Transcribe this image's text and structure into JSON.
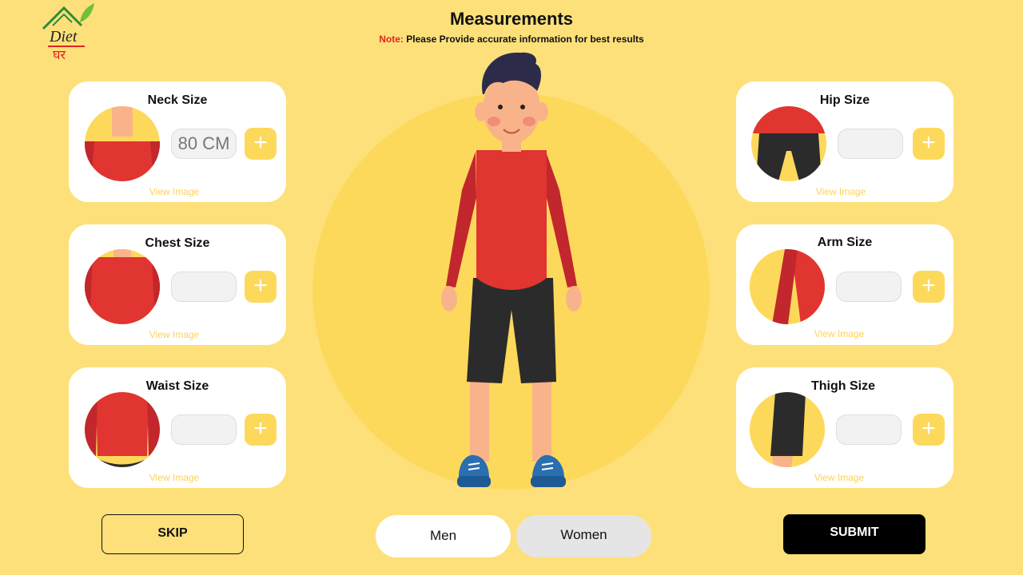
{
  "brand": {
    "logo_line1": "Diet",
    "logo_line2": "घर"
  },
  "header": {
    "title": "Measurements",
    "note_label": "Note:",
    "note_text": "Please Provide accurate information for best results"
  },
  "measurements": {
    "neck": {
      "title": "Neck Size",
      "value": "80 CM",
      "view_label": "View Image",
      "add_label": "+",
      "icon": "neck-icon"
    },
    "chest": {
      "title": "Chest Size",
      "value": "",
      "view_label": "View Image",
      "add_label": "+",
      "icon": "chest-icon"
    },
    "waist": {
      "title": "Waist Size",
      "value": "",
      "view_label": "View Image",
      "add_label": "+",
      "icon": "waist-icon"
    },
    "hip": {
      "title": "Hip Size",
      "value": "",
      "view_label": "View Image",
      "add_label": "+",
      "icon": "hip-icon"
    },
    "arm": {
      "title": "Arm Size",
      "value": "",
      "view_label": "View Image",
      "add_label": "+",
      "icon": "arm-icon"
    },
    "thigh": {
      "title": "Thigh Size",
      "value": "",
      "view_label": "View Image",
      "add_label": "+",
      "icon": "thigh-icon"
    }
  },
  "gender": {
    "men_label": "Men",
    "women_label": "Women",
    "selected": "Men"
  },
  "actions": {
    "skip_label": "SKIP",
    "submit_label": "SUBMIT"
  },
  "colors": {
    "background": "#fee07a",
    "accent": "#fdd95b",
    "shirt": "#e03530",
    "note_label": "#e02424"
  }
}
